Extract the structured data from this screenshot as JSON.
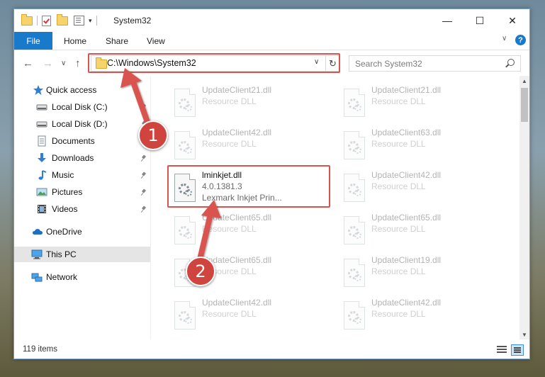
{
  "window": {
    "title": "System32"
  },
  "window_controls": {
    "minimize": "—",
    "maximize": "☐",
    "close": "✕"
  },
  "ribbon": {
    "file": "File",
    "tabs": [
      "Home",
      "Share",
      "View"
    ],
    "chevron": "∨",
    "help": "?"
  },
  "nav": {
    "back": "←",
    "forward": "→",
    "recent": "∨",
    "up": "↑"
  },
  "address": {
    "path": "C:\\Windows\\System32",
    "dropdown": "∨",
    "refresh": "↻"
  },
  "search": {
    "placeholder": "Search System32"
  },
  "sidebar": {
    "items": [
      {
        "label": "Quick access",
        "icon": "star-icon"
      },
      {
        "label": "Local Disk (C:)",
        "icon": "drive-icon"
      },
      {
        "label": "Local Disk (D:)",
        "icon": "drive-icon"
      },
      {
        "label": "Documents",
        "icon": "documents-icon"
      },
      {
        "label": "Downloads",
        "icon": "downloads-icon"
      },
      {
        "label": "Music",
        "icon": "music-icon"
      },
      {
        "label": "Pictures",
        "icon": "pictures-icon"
      },
      {
        "label": "Videos",
        "icon": "videos-icon"
      },
      {
        "label": "OneDrive",
        "icon": "cloud-icon"
      },
      {
        "label": "This PC",
        "icon": "computer-icon"
      },
      {
        "label": "Network",
        "icon": "network-icon"
      }
    ]
  },
  "files": {
    "left": [
      {
        "name": "UpdateClient21.dll",
        "desc": "Resource DLL"
      },
      {
        "name": "UpdateClient42.dll",
        "desc": "Resource DLL"
      },
      {
        "name": "lminkjet.dll",
        "desc": "4.0.1381.3",
        "desc2": "Lexmark Inkjet Prin..."
      },
      {
        "name": "UpdateClient65.dll",
        "desc": "Resource DLL"
      },
      {
        "name": "UpdateClient65.dll",
        "desc": "Resource DLL"
      },
      {
        "name": "UpdateClient42.dll",
        "desc": "Resource DLL"
      }
    ],
    "right": [
      {
        "name": "UpdateClient21.dll",
        "desc": "Resource DLL"
      },
      {
        "name": "UpdateClient63.dll",
        "desc": "Resource DLL"
      },
      {
        "name": "UpdateClient42.dll",
        "desc": "Resource DLL"
      },
      {
        "name": "UpdateClient65.dll",
        "desc": "Resource DLL"
      },
      {
        "name": "UpdateClient19.dll",
        "desc": "Resource DLL"
      },
      {
        "name": "UpdateClient42.dll",
        "desc": "Resource DLL"
      }
    ]
  },
  "status": {
    "item_count": "119 items"
  },
  "scrollbar": {
    "up": "▲",
    "down": "▼"
  },
  "annotations": {
    "step1": "1",
    "step2": "2",
    "accent": "#d9534f"
  },
  "colors": {
    "file_tab": "#1979ca",
    "selection": "#e5e5e5"
  }
}
